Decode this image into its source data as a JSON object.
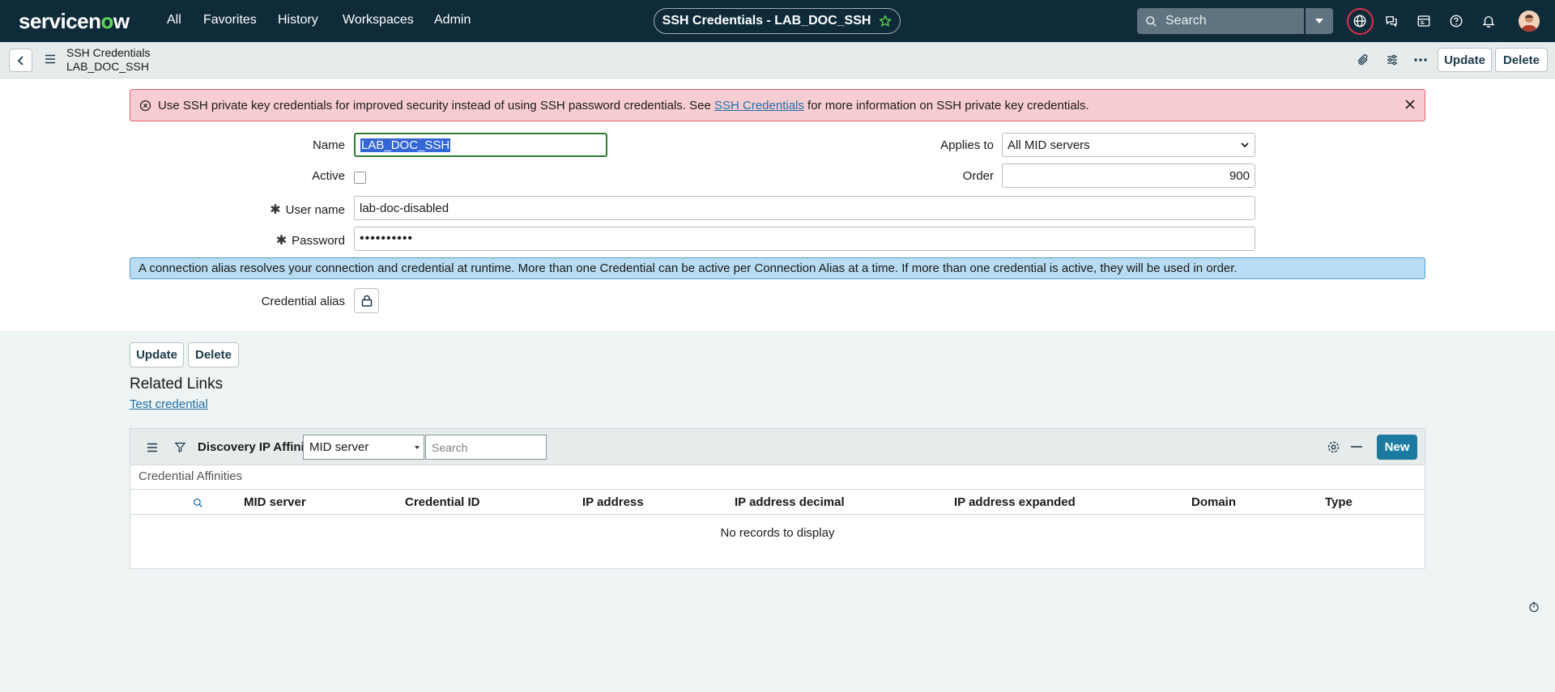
{
  "topnav": {
    "logo_pre": "servicen",
    "logo_o": "o",
    "logo_post": "w",
    "links": [
      "All",
      "Favorites",
      "History",
      "Workspaces",
      "Admin"
    ],
    "record_title": "SSH Credentials - LAB_DOC_SSH",
    "search_placeholder": "Search"
  },
  "record_header": {
    "table_name": "SSH Credentials",
    "record_name": "LAB_DOC_SSH",
    "update_label": "Update",
    "delete_label": "Delete"
  },
  "alert_error": {
    "text_before": "Use SSH private key credentials for improved security instead of using SSH password credentials. See ",
    "link": "SSH Credentials",
    "text_after": " for more information on SSH private key credentials."
  },
  "form": {
    "name_label": "Name",
    "name_value": "LAB_DOC_SSH",
    "active_label": "Active",
    "username_label": "User name",
    "username_value": "lab-doc-disabled",
    "password_label": "Password",
    "password_value": "••••••••••",
    "applies_to_label": "Applies to",
    "applies_to_value": "All MID servers",
    "order_label": "Order",
    "order_value": "900",
    "credential_alias_label": "Credential alias"
  },
  "alert_info": {
    "text": "A connection alias resolves your connection and credential at runtime. More than one Credential can be active per Connection Alias at a time. If more than one credential is active, they will be used in order."
  },
  "form_actions": {
    "update_label": "Update",
    "delete_label": "Delete"
  },
  "related_links": {
    "title": "Related Links",
    "items": [
      "Test credential"
    ]
  },
  "related_list": {
    "name": "Discovery IP Affinity",
    "filter_field": "MID server",
    "search_placeholder": "Search",
    "new_label": "New",
    "subtitle": "Credential Affinities",
    "columns": [
      "MID server",
      "Credential ID",
      "IP address",
      "IP address decimal",
      "IP address expanded",
      "Domain",
      "Type"
    ],
    "empty_text": "No records to display"
  },
  "colors": {
    "nav_bg": "#0f2b3a",
    "brand_green": "#62d84e",
    "error_bg": "#f8cdd2",
    "info_bg": "#b8dcf2",
    "primary_button": "#1c7aa0"
  }
}
